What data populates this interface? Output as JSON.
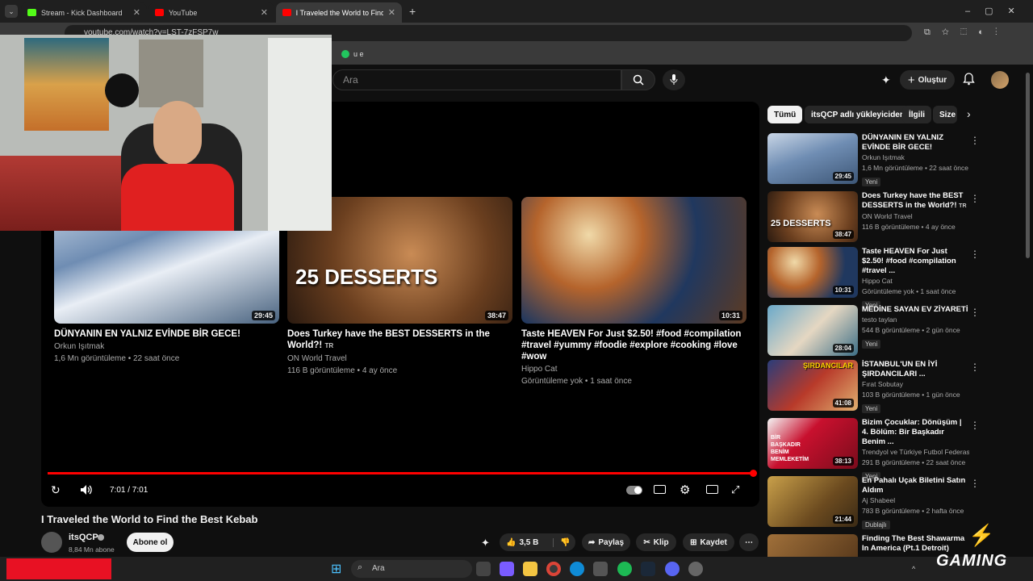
{
  "browser": {
    "tabs": [
      {
        "title": "Stream - Kick Dashboard",
        "active": false
      },
      {
        "title": "YouTube",
        "active": false
      },
      {
        "title": "I Traveled the World to Find the",
        "active": true
      }
    ],
    "url": "youtube.com/watch?v=LST-7zFSP7w",
    "bookmark_partial": "u e"
  },
  "youtube": {
    "search_placeholder": "Ara",
    "create_label": "Oluştur",
    "colors": {
      "accent": "#ff0000",
      "bg": "#0f0f0f"
    }
  },
  "player": {
    "time": "7:01 / 7:01",
    "progress_fraction": 1.0,
    "endcards": [
      {
        "title": "DÜNYANIN EN YALNIZ EVİNDE BİR GECE!",
        "channel": "Orkun Işıtmak",
        "meta": "1,6 Mn görüntüleme • 22 saat önce",
        "duration": "29:45"
      },
      {
        "title": "Does Turkey have the BEST DESSERTS in the World?!",
        "title_tag": "TR",
        "channel": "ON World Travel",
        "meta": "116 B görüntüleme • 4 ay önce",
        "duration": "38:47",
        "thumb_text": "25 DESSERTS"
      },
      {
        "title": "Taste HEAVEN For Just $2.50! #food #compilation #travel #yummy #foodie #explore #cooking #love #wow",
        "channel": "Hippo Cat",
        "meta": "Görüntüleme yok • 1 saat önce",
        "duration": "10:31"
      }
    ]
  },
  "video": {
    "title": "I Traveled the World to Find the Best Kebab",
    "channel": "itsQCP",
    "subscribers": "8,84 Mn abone",
    "subscribe_label": "Abone ol",
    "likes": "3,5 B",
    "share_label": "Paylaş",
    "clip_label": "Klip",
    "save_label": "Kaydet"
  },
  "sidebar": {
    "chips": [
      "Tümü",
      "itsQCP adlı yükleyiciden",
      "İlgili",
      "Size"
    ],
    "items": [
      {
        "title": "DÜNYANIN EN YALNIZ EVİNDE BİR GECE!",
        "channel": "Orkun Işıtmak",
        "meta": "1,6 Mn görüntüleme • 22 saat önce",
        "badge": "Yeni",
        "duration": "29:45"
      },
      {
        "title": "Does Turkey have the BEST DESSERTS in the World?!",
        "title_tag": "TR",
        "channel": "ON World Travel",
        "meta": "116 B görüntüleme • 4 ay önce",
        "badge": "",
        "duration": "38:47",
        "thumb_text": "25 DESSERTS"
      },
      {
        "title": "Taste HEAVEN For Just $2.50! #food #compilation #travel ...",
        "channel": "Hippo Cat",
        "meta": "Görüntüleme yok • 1 saat önce",
        "badge": "Yeni",
        "duration": "10:31"
      },
      {
        "title": "MEDİNE SAYAN EV ZİYARETİ",
        "channel": "testo taylan",
        "meta": "544 B görüntüleme • 2 gün önce",
        "badge": "Yeni",
        "duration": "28:04"
      },
      {
        "title": "İSTANBUL'UN EN İYİ ŞIRDANCILARI ...",
        "channel": "Fırat Sobutay",
        "meta": "103 B görüntüleme • 1 gün önce",
        "badge": "Yeni",
        "duration": "41:08",
        "thumb_text": "ŞIRDANCILAR"
      },
      {
        "title": "Bizim Çocuklar: Dönüşüm | 4. Bölüm: Bir Başkadır Benim ...",
        "channel": "Trendyol ve Türkiye Futbol Federasyonu",
        "meta": "291 B görüntüleme • 22 saat önce",
        "badge": "Yeni",
        "duration": "38:13",
        "thumb_text": "BİR BAŞKADIR BENİM MEMLEKETİM"
      },
      {
        "title": "En Pahalı Uçak Biletini Satın Aldım",
        "channel": "Aj Shabeel",
        "meta": "783 B görüntüleme • 2 hafta önce",
        "badge": "Dublajlı",
        "duration": "21:44"
      },
      {
        "title": "Finding The Best Shawarma In America (Pt.1 Detroit)",
        "channel": "",
        "meta": "",
        "badge": "",
        "duration": ""
      }
    ]
  },
  "taskbar": {
    "search_placeholder": "Ara"
  },
  "overlay": {
    "brand": "GAMING"
  }
}
